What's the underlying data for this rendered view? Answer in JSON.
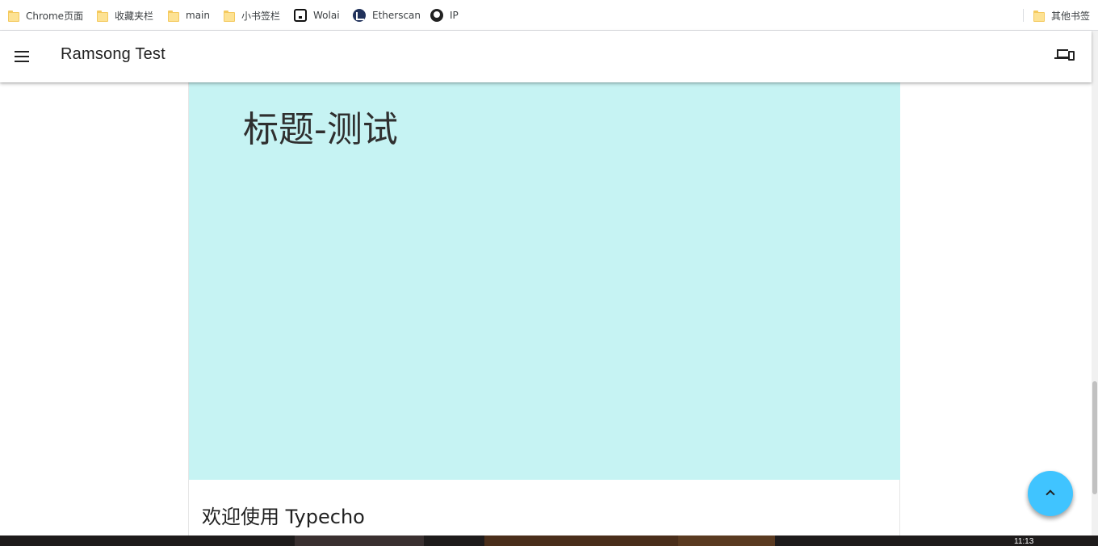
{
  "bookmarks": {
    "items": [
      {
        "label": "Chrome页面",
        "icon": "folder-icon"
      },
      {
        "label": "收藏夹栏",
        "icon": "folder-icon"
      },
      {
        "label": "main",
        "icon": "folder-icon"
      },
      {
        "label": "小书签栏",
        "icon": "folder-icon"
      },
      {
        "label": "Wolai",
        "icon": "wolai-icon"
      },
      {
        "label": "Etherscan",
        "icon": "etherscan-icon"
      },
      {
        "label": "IP",
        "icon": "ip-icon"
      }
    ],
    "other": {
      "label": "其他书签",
      "icon": "folder-icon"
    }
  },
  "app_bar": {
    "title": "Ramsong Test",
    "menu_icon": "menu-icon",
    "devices_icon": "devices-icon"
  },
  "post": {
    "banner_title": "标题-测试",
    "banner_color": "#c6f3f3",
    "title": "欢迎使用 Typecho"
  },
  "fab": {
    "icon": "chevron-up-icon",
    "color": "#40c4ff"
  },
  "taskbar": {
    "clock": "11:13"
  }
}
